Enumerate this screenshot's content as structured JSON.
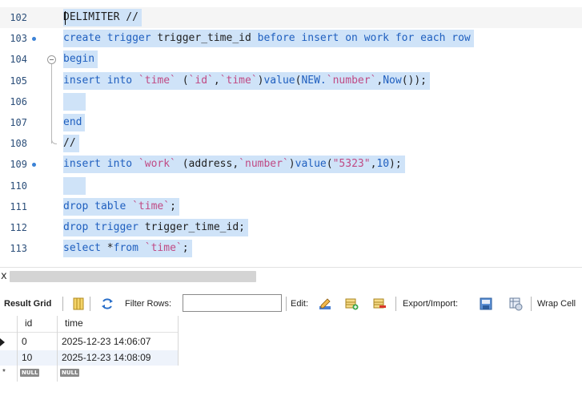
{
  "editor": {
    "lines": [
      {
        "num": "102",
        "current": true,
        "parts": [
          {
            "t": "DELIMITER //",
            "c": "plain"
          }
        ]
      },
      {
        "num": "103",
        "dot": true,
        "parts": [
          {
            "t": "create trigger ",
            "c": "kw"
          },
          {
            "t": "trigger_time_id ",
            "c": "plain"
          },
          {
            "t": "before insert on work for each row",
            "c": "kw"
          }
        ]
      },
      {
        "num": "104",
        "parts": [
          {
            "t": "begin",
            "c": "kw"
          }
        ]
      },
      {
        "num": "105",
        "parts": [
          {
            "t": "insert into ",
            "c": "kw"
          },
          {
            "t": "`time`",
            "c": "str"
          },
          {
            "t": " (",
            "c": "plain"
          },
          {
            "t": "`id`",
            "c": "str"
          },
          {
            "t": ",",
            "c": "plain"
          },
          {
            "t": "`time`",
            "c": "str"
          },
          {
            "t": ")",
            "c": "plain"
          },
          {
            "t": "value",
            "c": "kw"
          },
          {
            "t": "(",
            "c": "plain"
          },
          {
            "t": "NEW.",
            "c": "kw"
          },
          {
            "t": "`number`",
            "c": "str"
          },
          {
            "t": ",",
            "c": "plain"
          },
          {
            "t": "Now",
            "c": "fn"
          },
          {
            "t": "());",
            "c": "plain"
          }
        ]
      },
      {
        "num": "106",
        "parts": []
      },
      {
        "num": "107",
        "parts": [
          {
            "t": "end",
            "c": "kw"
          }
        ]
      },
      {
        "num": "108",
        "parts": [
          {
            "t": "//",
            "c": "plain"
          }
        ]
      },
      {
        "num": "109",
        "dot": true,
        "parts": [
          {
            "t": "insert into ",
            "c": "kw"
          },
          {
            "t": "`work`",
            "c": "str"
          },
          {
            "t": " (address,",
            "c": "plain"
          },
          {
            "t": "`number`",
            "c": "str"
          },
          {
            "t": ")",
            "c": "plain"
          },
          {
            "t": "value",
            "c": "kw"
          },
          {
            "t": "(",
            "c": "plain"
          },
          {
            "t": "\"5323\"",
            "c": "str"
          },
          {
            "t": ",",
            "c": "plain"
          },
          {
            "t": "10",
            "c": "num"
          },
          {
            "t": ");",
            "c": "plain"
          }
        ]
      },
      {
        "num": "110",
        "parts": []
      },
      {
        "num": "111",
        "parts": [
          {
            "t": "drop table ",
            "c": "kw"
          },
          {
            "t": "`time`",
            "c": "str"
          },
          {
            "t": ";",
            "c": "plain"
          }
        ]
      },
      {
        "num": "112",
        "parts": [
          {
            "t": "drop trigger ",
            "c": "kw"
          },
          {
            "t": "trigger_time_id;",
            "c": "plain"
          }
        ]
      },
      {
        "num": "113",
        "parts": [
          {
            "t": "select ",
            "c": "kw"
          },
          {
            "t": "*",
            "c": "plain"
          },
          {
            "t": "from ",
            "c": "kw"
          },
          {
            "t": "`time`",
            "c": "str"
          },
          {
            "t": ";",
            "c": "plain"
          }
        ]
      }
    ]
  },
  "splitter": {
    "close_glyph": "x"
  },
  "toolbar": {
    "result_grid": "Result Grid",
    "filter_rows": "Filter Rows:",
    "edit": "Edit:",
    "export_import": "Export/Import:",
    "wrap_cell": "Wrap Cell"
  },
  "grid": {
    "columns": [
      "id",
      "time"
    ],
    "rows": [
      {
        "id": "0",
        "time": "2025-12-23 14:06:07",
        "marker": "current"
      },
      {
        "id": "10",
        "time": "2025-12-23 14:08:09"
      }
    ],
    "new_row": {
      "id": "NULL",
      "time": "NULL",
      "marker": "*"
    }
  },
  "colors": {
    "selection": "#cfe3f8",
    "keyword": "#1f5fbf",
    "string": "#c04a84",
    "line_number": "#2c4f7a",
    "breakpoint_dot": "#3b82d6"
  }
}
